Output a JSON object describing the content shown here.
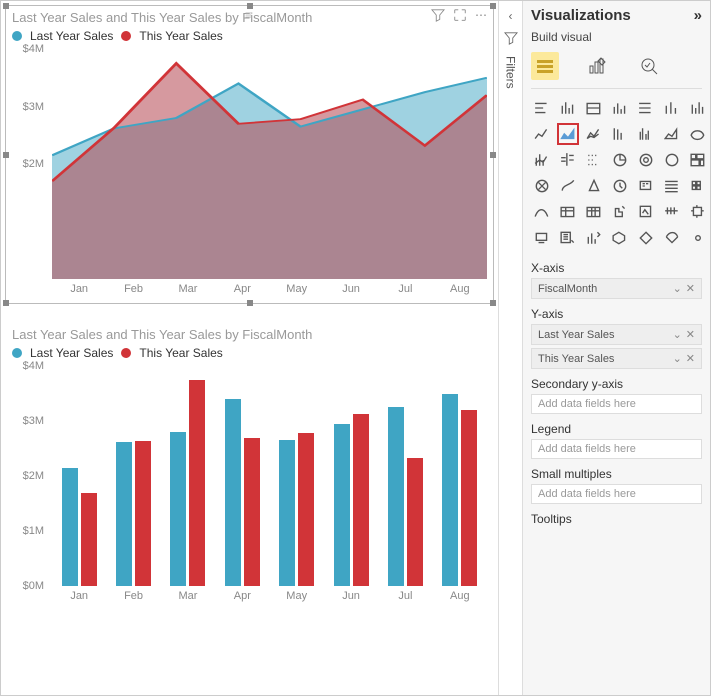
{
  "colors": {
    "lastYear": "#3fa5c4",
    "thisYear": "#d13438",
    "areaFillLast": "rgba(63,165,196,0.5)",
    "areaFillThis": "rgba(180,70,80,0.55)"
  },
  "chart_data": [
    {
      "type": "area",
      "title": "Last Year Sales and This Year Sales by FiscalMonth",
      "xlabel": "",
      "ylabel": "",
      "ylim": [
        0,
        4000000
      ],
      "yticks": [
        "$4M",
        "$3M",
        "$2M"
      ],
      "categories": [
        "Jan",
        "Feb",
        "Mar",
        "Apr",
        "May",
        "Jun",
        "Jul",
        "Aug"
      ],
      "series": [
        {
          "name": "Last Year Sales",
          "values": [
            2150000,
            2620000,
            2800000,
            3400000,
            2650000,
            2950000,
            3250000,
            3500000
          ]
        },
        {
          "name": "This Year Sales",
          "values": [
            1700000,
            2630000,
            3750000,
            2700000,
            2780000,
            3120000,
            2320000,
            3200000
          ]
        }
      ]
    },
    {
      "type": "bar",
      "title": "Last Year Sales and This Year Sales by FiscalMonth",
      "xlabel": "",
      "ylabel": "",
      "ylim": [
        0,
        4000000
      ],
      "yticks": [
        "$4M",
        "$3M",
        "$2M",
        "$1M",
        "$0M"
      ],
      "categories": [
        "Jan",
        "Feb",
        "Mar",
        "Apr",
        "May",
        "Jun",
        "Jul",
        "Aug"
      ],
      "series": [
        {
          "name": "Last Year Sales",
          "values": [
            2150000,
            2620000,
            2800000,
            3400000,
            2650000,
            2950000,
            3250000,
            3500000
          ]
        },
        {
          "name": "This Year Sales",
          "values": [
            1700000,
            2630000,
            3750000,
            2700000,
            2780000,
            3120000,
            2320000,
            3200000
          ]
        }
      ]
    }
  ],
  "filters": {
    "label": "Filters"
  },
  "viz": {
    "title": "Visualizations",
    "subtitle": "Build visual",
    "xaxis": {
      "label": "X-axis",
      "field": "FiscalMonth"
    },
    "yaxis": {
      "label": "Y-axis",
      "field1": "Last Year Sales",
      "field2": "This Year Sales"
    },
    "secondary": {
      "label": "Secondary y-axis",
      "placeholder": "Add data fields here"
    },
    "legend": {
      "label": "Legend",
      "placeholder": "Add data fields here"
    },
    "small": {
      "label": "Small multiples",
      "placeholder": "Add data fields here"
    },
    "tooltips": {
      "label": "Tooltips"
    }
  }
}
